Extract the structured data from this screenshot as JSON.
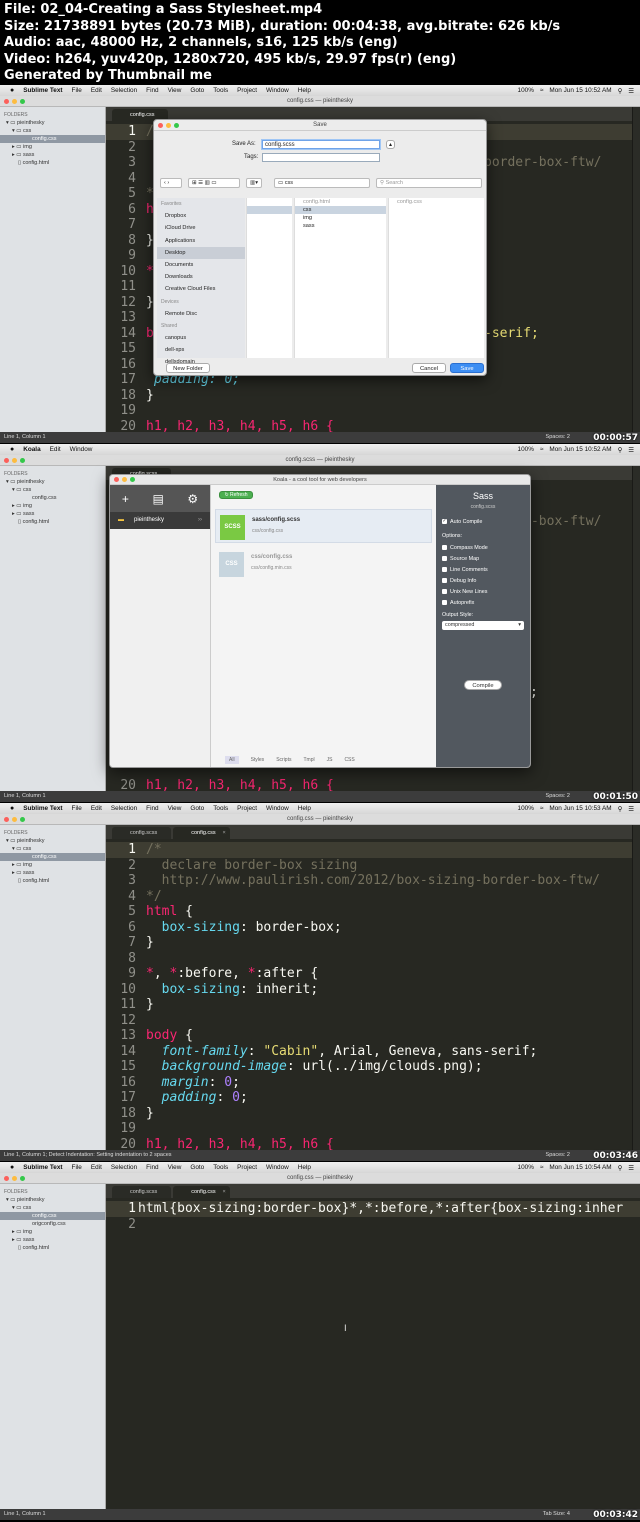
{
  "header": {
    "file": "File: 02_04-Creating a Sass Stylesheet.mp4",
    "size": "Size: 21738891 bytes (20.73 MiB), duration: 00:04:38, avg.bitrate: 626 kb/s",
    "audio": "Audio: aac, 48000 Hz, 2 channels, s16, 125 kb/s (eng)",
    "video": "Video: h264, yuv420p, 1280x720, 495 kb/s, 29.97 fps(r) (eng)",
    "generated": "Generated by Thumbnail me"
  },
  "menubar": {
    "apple": "",
    "app": "Sublime Text",
    "items": [
      "File",
      "Edit",
      "Selection",
      "Find",
      "View",
      "Goto",
      "Tools",
      "Project",
      "Window",
      "Help"
    ],
    "battery": "100%",
    "clock1": "Mon Jun 15  10:52 AM",
    "clock2": "Mon Jun 15  10:52 AM",
    "clock3": "Mon Jun 15  10:53 AM",
    "clock4": "Mon Jun 15  10:54 AM",
    "koala_app": "Koala",
    "koala_items": [
      "Edit",
      "Window"
    ]
  },
  "titles": {
    "f1": "config.css — pieinthesky",
    "f2": "config.scss — pieinthesky",
    "f3": "config.css — pieinthesky",
    "f4": "config.css — pieinthesky"
  },
  "tabs": {
    "scss": "config.scss",
    "css": "config.css"
  },
  "sidebar": {
    "folders": "FOLDERS",
    "project": "pieinthesky",
    "css": "css",
    "config_css": "config.css",
    "img": "img",
    "sass": "sass",
    "config_html": "config.html",
    "origconfig": "origconfig.css"
  },
  "code": {
    "l1": "/*",
    "l2a": "  declare border-box sizing",
    "l3": "  http://www.paulirish.com/2012/box-sizing-border-box-ftw/",
    "l4": "*/",
    "l5": "html",
    "l6p": "box-sizing",
    "l6v": "border-box",
    "l8a": "*, *:before, *:after",
    "l10p": "box-sizing",
    "l10v": "inherit",
    "l13": "body",
    "l14p": "font-family",
    "l14s": "\"Cabin\"",
    "l14v": "Arial, Geneva, sans-serif",
    "l15p": "background-image",
    "l15v": "url(../img/clouds.png)",
    "l16p": "margin",
    "l16v": "0",
    "l17p": "padding",
    "l17v": "0",
    "l20": "h1, h2, h3, h4, h5, h6 {",
    "frag_ftw": "border-box-ftw/",
    "frag_serif": "-serif;",
    "frag_padding": "padding: 0;",
    "minified": "html{box-sizing:border-box}*,*:before,*:after{box-sizing:inher"
  },
  "status": {
    "s1": "Line 1, Column 1",
    "s2": "Line 1, Column 1",
    "s3": "Line 1, Column 1; Detect Indentation: Setting indentation to 2 spaces",
    "s4": "Line 1, Column 1",
    "spaces": "Spaces: 2",
    "tabsize": "Tab Size: 4"
  },
  "timestamps": {
    "t1": "00:00:57",
    "t2": "00:01:50",
    "t3": "00:03:46",
    "t4": "00:03:42"
  },
  "save_dialog": {
    "title": "Save",
    "save_as_label": "Save As:",
    "save_as_value": "config.scss",
    "tags_label": "Tags:",
    "location": "css",
    "search_placeholder": "Search",
    "favorites_header": "Favorites",
    "favorites": [
      "Dropbox",
      "iCloud Drive",
      "Applications",
      "Desktop",
      "Documents",
      "Downloads",
      "Creative Cloud Files"
    ],
    "devices_header": "Devices",
    "devices": [
      "Remote Disc"
    ],
    "shared_header": "Shared",
    "shared": [
      "canopus",
      "dell-xps",
      "dellxdomain"
    ],
    "col2": [
      "config.html",
      "css",
      "img",
      "sass"
    ],
    "col3": [
      "config.css"
    ],
    "new_folder": "New Folder",
    "cancel": "Cancel",
    "save": "Save"
  },
  "koala": {
    "title": "Koala - a cool tool for web developers",
    "refresh": "Refresh",
    "project": "pieinthesky",
    "file1_badge": "SCSS",
    "file1_name": "sass/config.scss",
    "file1_out": "css/config.css",
    "file2_badge": "CSS",
    "file2_name": "css/config.css",
    "file2_out": "css/config.min.css",
    "panel_title": "Sass",
    "panel_sub": "config.scss",
    "auto_compile": "Auto Compile",
    "options": "Options:",
    "opts": [
      "Compass Mode",
      "Source Map",
      "Line Comments",
      "Debug Info",
      "Unix New Lines",
      "Autoprefix"
    ],
    "output_style_label": "Output Style:",
    "output_style": "compressed",
    "compile": "Compile",
    "filters": [
      "All",
      "Styles",
      "Scripts",
      "Tmpl",
      "JS",
      "CSS"
    ]
  }
}
